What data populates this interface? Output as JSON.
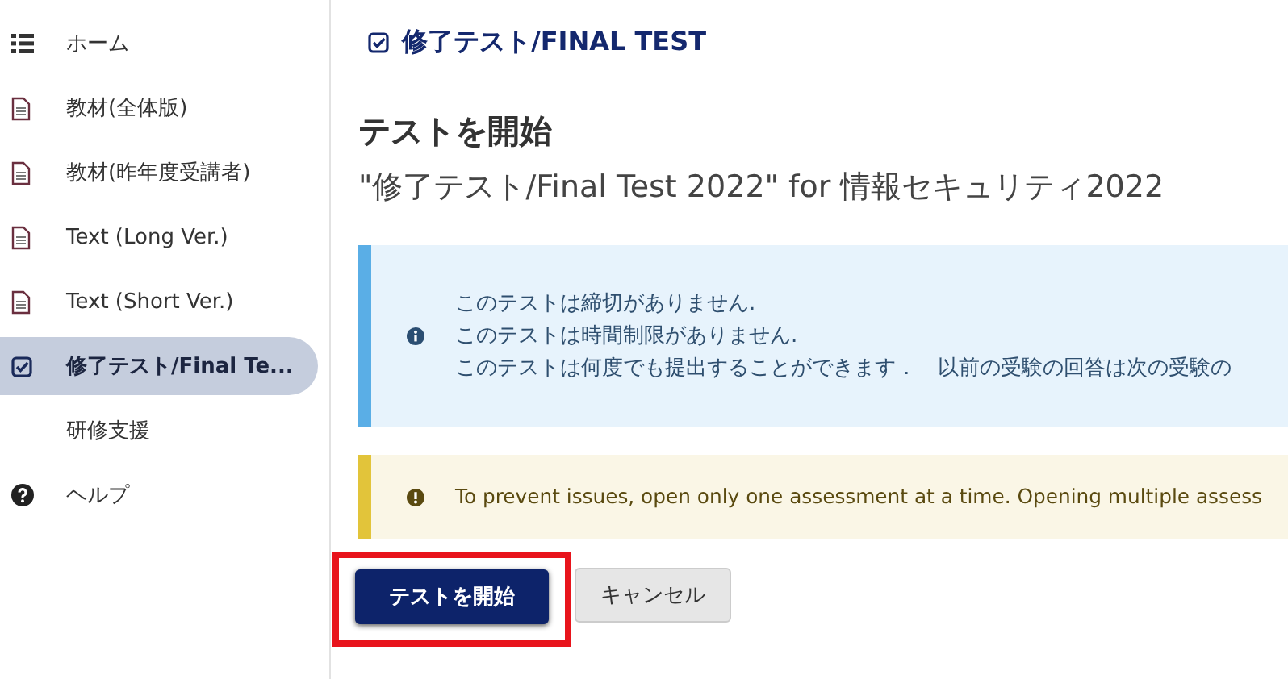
{
  "sidebar": {
    "items": [
      {
        "label": "ホーム",
        "kind": "list",
        "selected": false
      },
      {
        "label": "教材(全体版)",
        "kind": "document",
        "selected": false
      },
      {
        "label": "教材(昨年度受講者)",
        "kind": "document",
        "selected": false
      },
      {
        "label": "Text (Long Ver.)",
        "kind": "document",
        "selected": false
      },
      {
        "label": "Text (Short Ver.)",
        "kind": "document",
        "selected": false
      },
      {
        "label": "修了テスト/Final Te...",
        "kind": "check",
        "selected": true
      },
      {
        "label": "研修支援",
        "kind": "plain",
        "selected": false
      },
      {
        "label": "ヘルプ",
        "kind": "help",
        "selected": false
      }
    ]
  },
  "header": {
    "title": "修了テスト/FINAL TEST"
  },
  "heading": "テストを開始",
  "subtitle": "\"修了テスト/Final Test 2022\" for 情報セキュリティ2022",
  "alerts": [
    {
      "kind": "info",
      "lines": [
        "このテストは締切がありません.",
        "このテストは時間制限がありません.",
        "このテストは何度でも提出することができます．　以前の受験の回答は次の受験の"
      ]
    },
    {
      "kind": "warning",
      "lines": [
        "To prevent issues, open only one assessment at a time. Opening multiple assess"
      ]
    }
  ],
  "buttons": [
    {
      "label": "テストを開始",
      "kind": "primary",
      "highlighted": true
    },
    {
      "label": "キャンセル",
      "kind": "secondary",
      "highlighted": false
    }
  ]
}
